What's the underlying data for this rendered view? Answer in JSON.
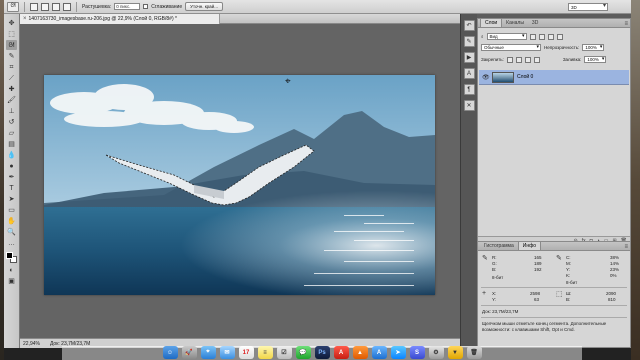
{
  "options_bar": {
    "feather_label": "Растушевка:",
    "feather_value": "0 пикс.",
    "antialias_label": "Сглаживание",
    "refine_edge_button": "Уточн. край...",
    "workspace": "3D"
  },
  "document": {
    "tab_title": "1407163730_imagesbase.ru-206.jpg @ 22,9% (Слой 0, RGB/8#) *",
    "zoom": "22,94%",
    "doc_size": "Док: 23,7M/23,7M"
  },
  "panels": {
    "layers": {
      "tabs": [
        "Слои",
        "Каналы",
        "3D"
      ],
      "filter_kind": "Вид",
      "blend_mode": "Обычные",
      "opacity_label": "Непрозрачность:",
      "opacity_value": "100%",
      "lock_label": "Закрепить:",
      "fill_label": "Заливка:",
      "fill_value": "100%",
      "layer_name": "Слой 0"
    },
    "info": {
      "tabs": [
        "Гистограмма",
        "Инфо"
      ],
      "rgb_labels": [
        "R:",
        "G:",
        "B:"
      ],
      "rgb_values": [
        "165",
        "189",
        "192"
      ],
      "cmyk_labels": [
        "C:",
        "M:",
        "Y:",
        "K:"
      ],
      "cmyk_values": [
        "38%",
        "14%",
        "23%",
        "0%"
      ],
      "bit_left": "8-бит",
      "bit_right": "8-бит",
      "x_label": "X:",
      "x_value": "2598",
      "y_label": "Y:",
      "y_value": "63",
      "w_label": "Ш:",
      "w_value": "2090",
      "h_label": "В:",
      "h_value": "810",
      "doc_size": "Док: 23,7M/23,7M",
      "hint": "Щелчком мыши отметьте конец сегмента. Дополнительные возможности: с клавишами Shift, Opt и Cmd."
    }
  },
  "icons": {
    "tools": [
      "move-icon",
      "marquee-icon",
      "lasso-icon",
      "quick-select-icon",
      "crop-icon",
      "eyedropper-icon",
      "healing-icon",
      "brush-icon",
      "stamp-icon",
      "history-brush-icon",
      "eraser-icon",
      "gradient-icon",
      "blur-icon",
      "dodge-icon",
      "pen-icon",
      "type-icon",
      "path-select-icon",
      "shape-icon",
      "hand-icon",
      "zoom-icon"
    ]
  },
  "colors": {
    "selection_row": "#9bb4e0",
    "canvas_gray": "#646464",
    "panel_bg": "#d6d6d6"
  }
}
